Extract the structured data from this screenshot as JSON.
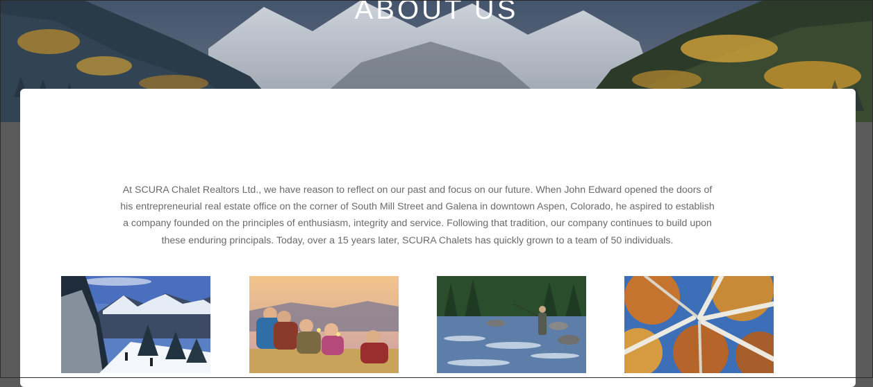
{
  "hero": {
    "title": "ABOUT US"
  },
  "about": {
    "intro": "At SCURA Chalet Realtors Ltd., we have reason to reflect on our past and focus on our future. When John Edward opened the doors of his entrepreneurial real estate office on the corner of South Mill Street and Galena in downtown Aspen, Colorado, he aspired to establish a company founded on the principles of enthusiasm, integrity and service. Following that tradition, our company continues to build upon these enduring principals. Today, over a 15 years later, SCURA Chalets has quickly grown to a team of 50 individuals."
  },
  "gallery": {
    "images": [
      {
        "subject": "snowy-mountain-skiers-photo"
      },
      {
        "subject": "friends-picnic-toast-photo"
      },
      {
        "subject": "river-fly-fishing-photo"
      },
      {
        "subject": "aspen-trees-autumn-photo"
      }
    ]
  },
  "colors": {
    "page_background": "#5a5a5a",
    "card_background": "#ffffff",
    "body_text": "#6a6a6a",
    "hero_title": "#ffffff"
  }
}
